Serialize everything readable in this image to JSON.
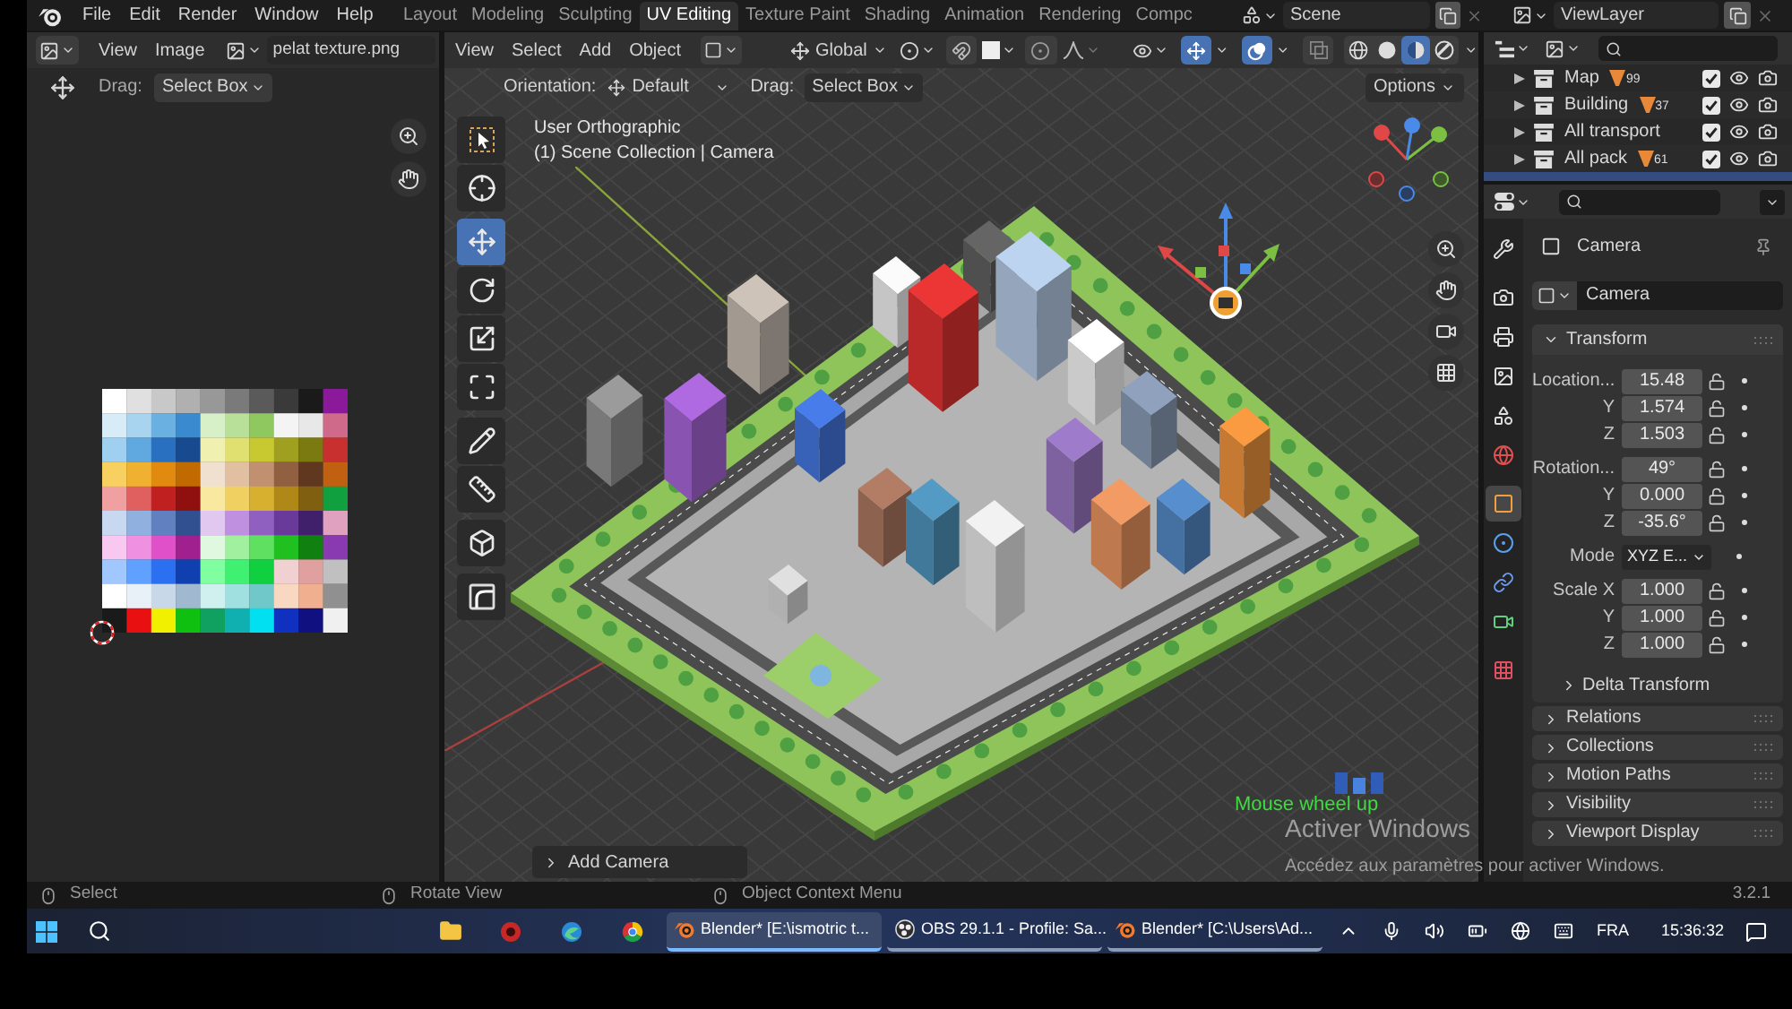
{
  "top_bar": {
    "menus": [
      "File",
      "Edit",
      "Render",
      "Window",
      "Help"
    ],
    "workspaces": [
      {
        "label": "Layout",
        "selected": false
      },
      {
        "label": "Modeling",
        "selected": false
      },
      {
        "label": "Sculpting",
        "selected": false
      },
      {
        "label": "UV Editing",
        "selected": true
      },
      {
        "label": "Texture Paint",
        "selected": false
      },
      {
        "label": "Shading",
        "selected": false
      },
      {
        "label": "Animation",
        "selected": false
      },
      {
        "label": "Rendering",
        "selected": false
      },
      {
        "label": "Compc",
        "selected": false
      }
    ],
    "scene": "Scene",
    "view_layer": "ViewLayer"
  },
  "image_editor": {
    "menus": [
      "View",
      "Image"
    ],
    "image_name": "pelat texture.png",
    "drag_label": "Drag:",
    "drag_mode": "Select Box"
  },
  "viewport": {
    "menus": [
      "View",
      "Select",
      "Add",
      "Object"
    ],
    "transform_orientation": "Global",
    "snap_on": false,
    "proportional_on": false,
    "gizmos_on": true,
    "overlays_on": true,
    "xray_on": false,
    "shading": [
      {
        "selected": false
      },
      {
        "selected": false
      },
      {
        "selected": true
      },
      {
        "selected": false
      }
    ],
    "orientation_label": "Orientation:",
    "orientation": "Default",
    "drag_label": "Drag:",
    "drag_mode": "Select Box",
    "options": "Options",
    "view_name": "User Orthographic",
    "collection_path": "(1) Scene Collection | Camera",
    "tools": [
      {
        "selected": false
      },
      {
        "selected": false
      },
      {
        "selected": true
      },
      {
        "selected": false
      },
      {
        "selected": false
      },
      {
        "selected": false
      },
      {
        "selected": false
      },
      {
        "selected": false
      },
      {
        "selected": false
      },
      {
        "selected": false
      }
    ],
    "last_operator": "Add Camera",
    "key_hint": "Mouse wheel up"
  },
  "activation_notice": {
    "title": "Activer Windows",
    "text": "Accédez aux paramètres pour activer Windows."
  },
  "outliner": {
    "rows": [
      {
        "name": "Map",
        "count": "99",
        "checked": true,
        "selected": false
      },
      {
        "name": "Building",
        "count": "37",
        "checked": true,
        "selected": false
      },
      {
        "name": "All transport",
        "checked": true,
        "selected": false
      },
      {
        "name": "All pack",
        "count": "61",
        "checked": true,
        "selected": false
      },
      {
        "selected": true
      }
    ]
  },
  "properties": {
    "tabs": [
      {
        "selected": false
      },
      {
        "selected": false
      },
      {
        "selected": false
      },
      {
        "selected": false
      },
      {
        "selected": false
      },
      {
        "selected": false
      },
      {
        "selected": true
      },
      {
        "selected": false
      },
      {
        "selected": false
      },
      {
        "selected": false
      },
      {
        "selected": false
      }
    ],
    "context": "Camera",
    "object_name": "Camera",
    "transform": {
      "title": "Transform",
      "expanded": true,
      "groups": [
        {
          "rows": [
            {
              "kind": "number",
              "label": "Location...",
              "value": "15.48",
              "locked": false
            },
            {
              "kind": "number",
              "label": "Y",
              "value": "1.574",
              "locked": false
            },
            {
              "kind": "number",
              "label": "Z",
              "value": "1.503",
              "locked": false
            }
          ]
        },
        {
          "rows": [
            {
              "kind": "number",
              "label": "Rotation...",
              "value": "49°",
              "locked": false
            },
            {
              "kind": "number",
              "label": "Y",
              "value": "0.000",
              "locked": false
            },
            {
              "kind": "number",
              "label": "Z",
              "value": "-35.6°",
              "locked": false
            }
          ]
        },
        {
          "rows": [
            {
              "kind": "dropdown",
              "label": "Mode",
              "value": "XYZ E..."
            }
          ]
        },
        {
          "rows": [
            {
              "kind": "number",
              "label": "Scale X",
              "value": "1.000",
              "locked": false
            },
            {
              "kind": "number",
              "label": "Y",
              "value": "1.000",
              "locked": false
            },
            {
              "kind": "number",
              "label": "Z",
              "value": "1.000",
              "locked": false
            }
          ]
        }
      ],
      "subpanel": {
        "title": "Delta Transform",
        "expanded": false
      }
    },
    "panels": [
      {
        "title": "Relations",
        "expanded": false
      },
      {
        "title": "Collections",
        "expanded": false
      },
      {
        "title": "Motion Paths",
        "expanded": false
      },
      {
        "title": "Visibility",
        "expanded": false
      },
      {
        "title": "Viewport Display",
        "expanded": false
      }
    ]
  },
  "status_bar": {
    "hints": [
      "Select",
      "Rotate View",
      "Object Context Menu"
    ],
    "version": "3.2.1"
  },
  "taskbar": {
    "tasks": [
      {
        "label": "Blender* [E:\\ismotric t...",
        "selected": true
      },
      {
        "label": "OBS 29.1.1 - Profile: Sa...",
        "selected": false
      },
      {
        "label": "Blender* [C:\\Users\\Ad...",
        "selected": false
      }
    ],
    "language": "FRA",
    "time": "15:36:32"
  }
}
